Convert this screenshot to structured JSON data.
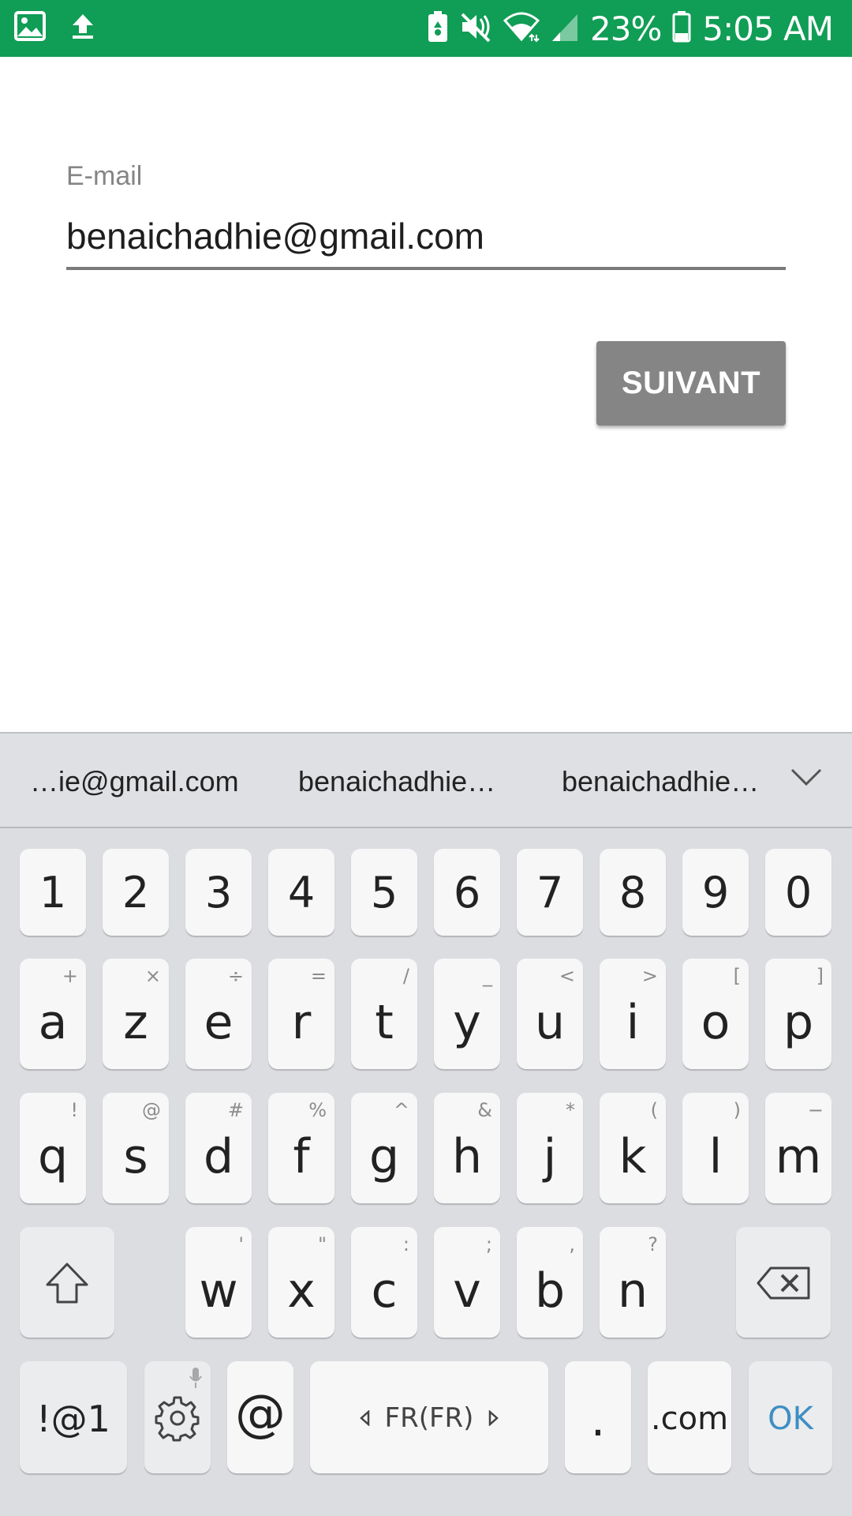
{
  "status_bar": {
    "battery_percent": "23%",
    "time": "5:05 AM",
    "left_icons": [
      "image-icon",
      "upload-icon"
    ],
    "right_icons": [
      "battery-saver-icon",
      "mute-icon",
      "wifi-icon",
      "signal-icon",
      "battery-icon"
    ],
    "background": "#109d55"
  },
  "form": {
    "email_label": "E-mail",
    "email_value": "benaichadhie@gmail.com",
    "next_button": "SUIVANT"
  },
  "keyboard": {
    "suggestions": [
      "…ie@gmail.com",
      "benaichadhie…",
      "benaichadhie…"
    ],
    "numbers": [
      "1",
      "2",
      "3",
      "4",
      "5",
      "6",
      "7",
      "8",
      "9",
      "0"
    ],
    "row1": [
      {
        "k": "a",
        "h": "+"
      },
      {
        "k": "z",
        "h": "×"
      },
      {
        "k": "e",
        "h": "÷"
      },
      {
        "k": "r",
        "h": "="
      },
      {
        "k": "t",
        "h": "/"
      },
      {
        "k": "y",
        "h": "_"
      },
      {
        "k": "u",
        "h": "<"
      },
      {
        "k": "i",
        "h": ">"
      },
      {
        "k": "o",
        "h": "["
      },
      {
        "k": "p",
        "h": "]"
      }
    ],
    "row2": [
      {
        "k": "q",
        "h": "!"
      },
      {
        "k": "s",
        "h": "@"
      },
      {
        "k": "d",
        "h": "#"
      },
      {
        "k": "f",
        "h": "%"
      },
      {
        "k": "g",
        "h": "^"
      },
      {
        "k": "h",
        "h": "&"
      },
      {
        "k": "j",
        "h": "*"
      },
      {
        "k": "k",
        "h": "("
      },
      {
        "k": "l",
        "h": ")"
      },
      {
        "k": "m",
        "h": "−"
      }
    ],
    "row3": [
      {
        "k": "w",
        "h": "'"
      },
      {
        "k": "x",
        "h": "\""
      },
      {
        "k": "c",
        "h": ":"
      },
      {
        "k": "v",
        "h": ";"
      },
      {
        "k": "b",
        "h": ","
      },
      {
        "k": "n",
        "h": "?"
      }
    ],
    "symbols_key": "!@1",
    "at_key": "@",
    "space_label": "FR(FR)",
    "period_key": ".",
    "com_key": ".com",
    "ok_key": "OK",
    "ok_color": "#3f8ec3"
  }
}
